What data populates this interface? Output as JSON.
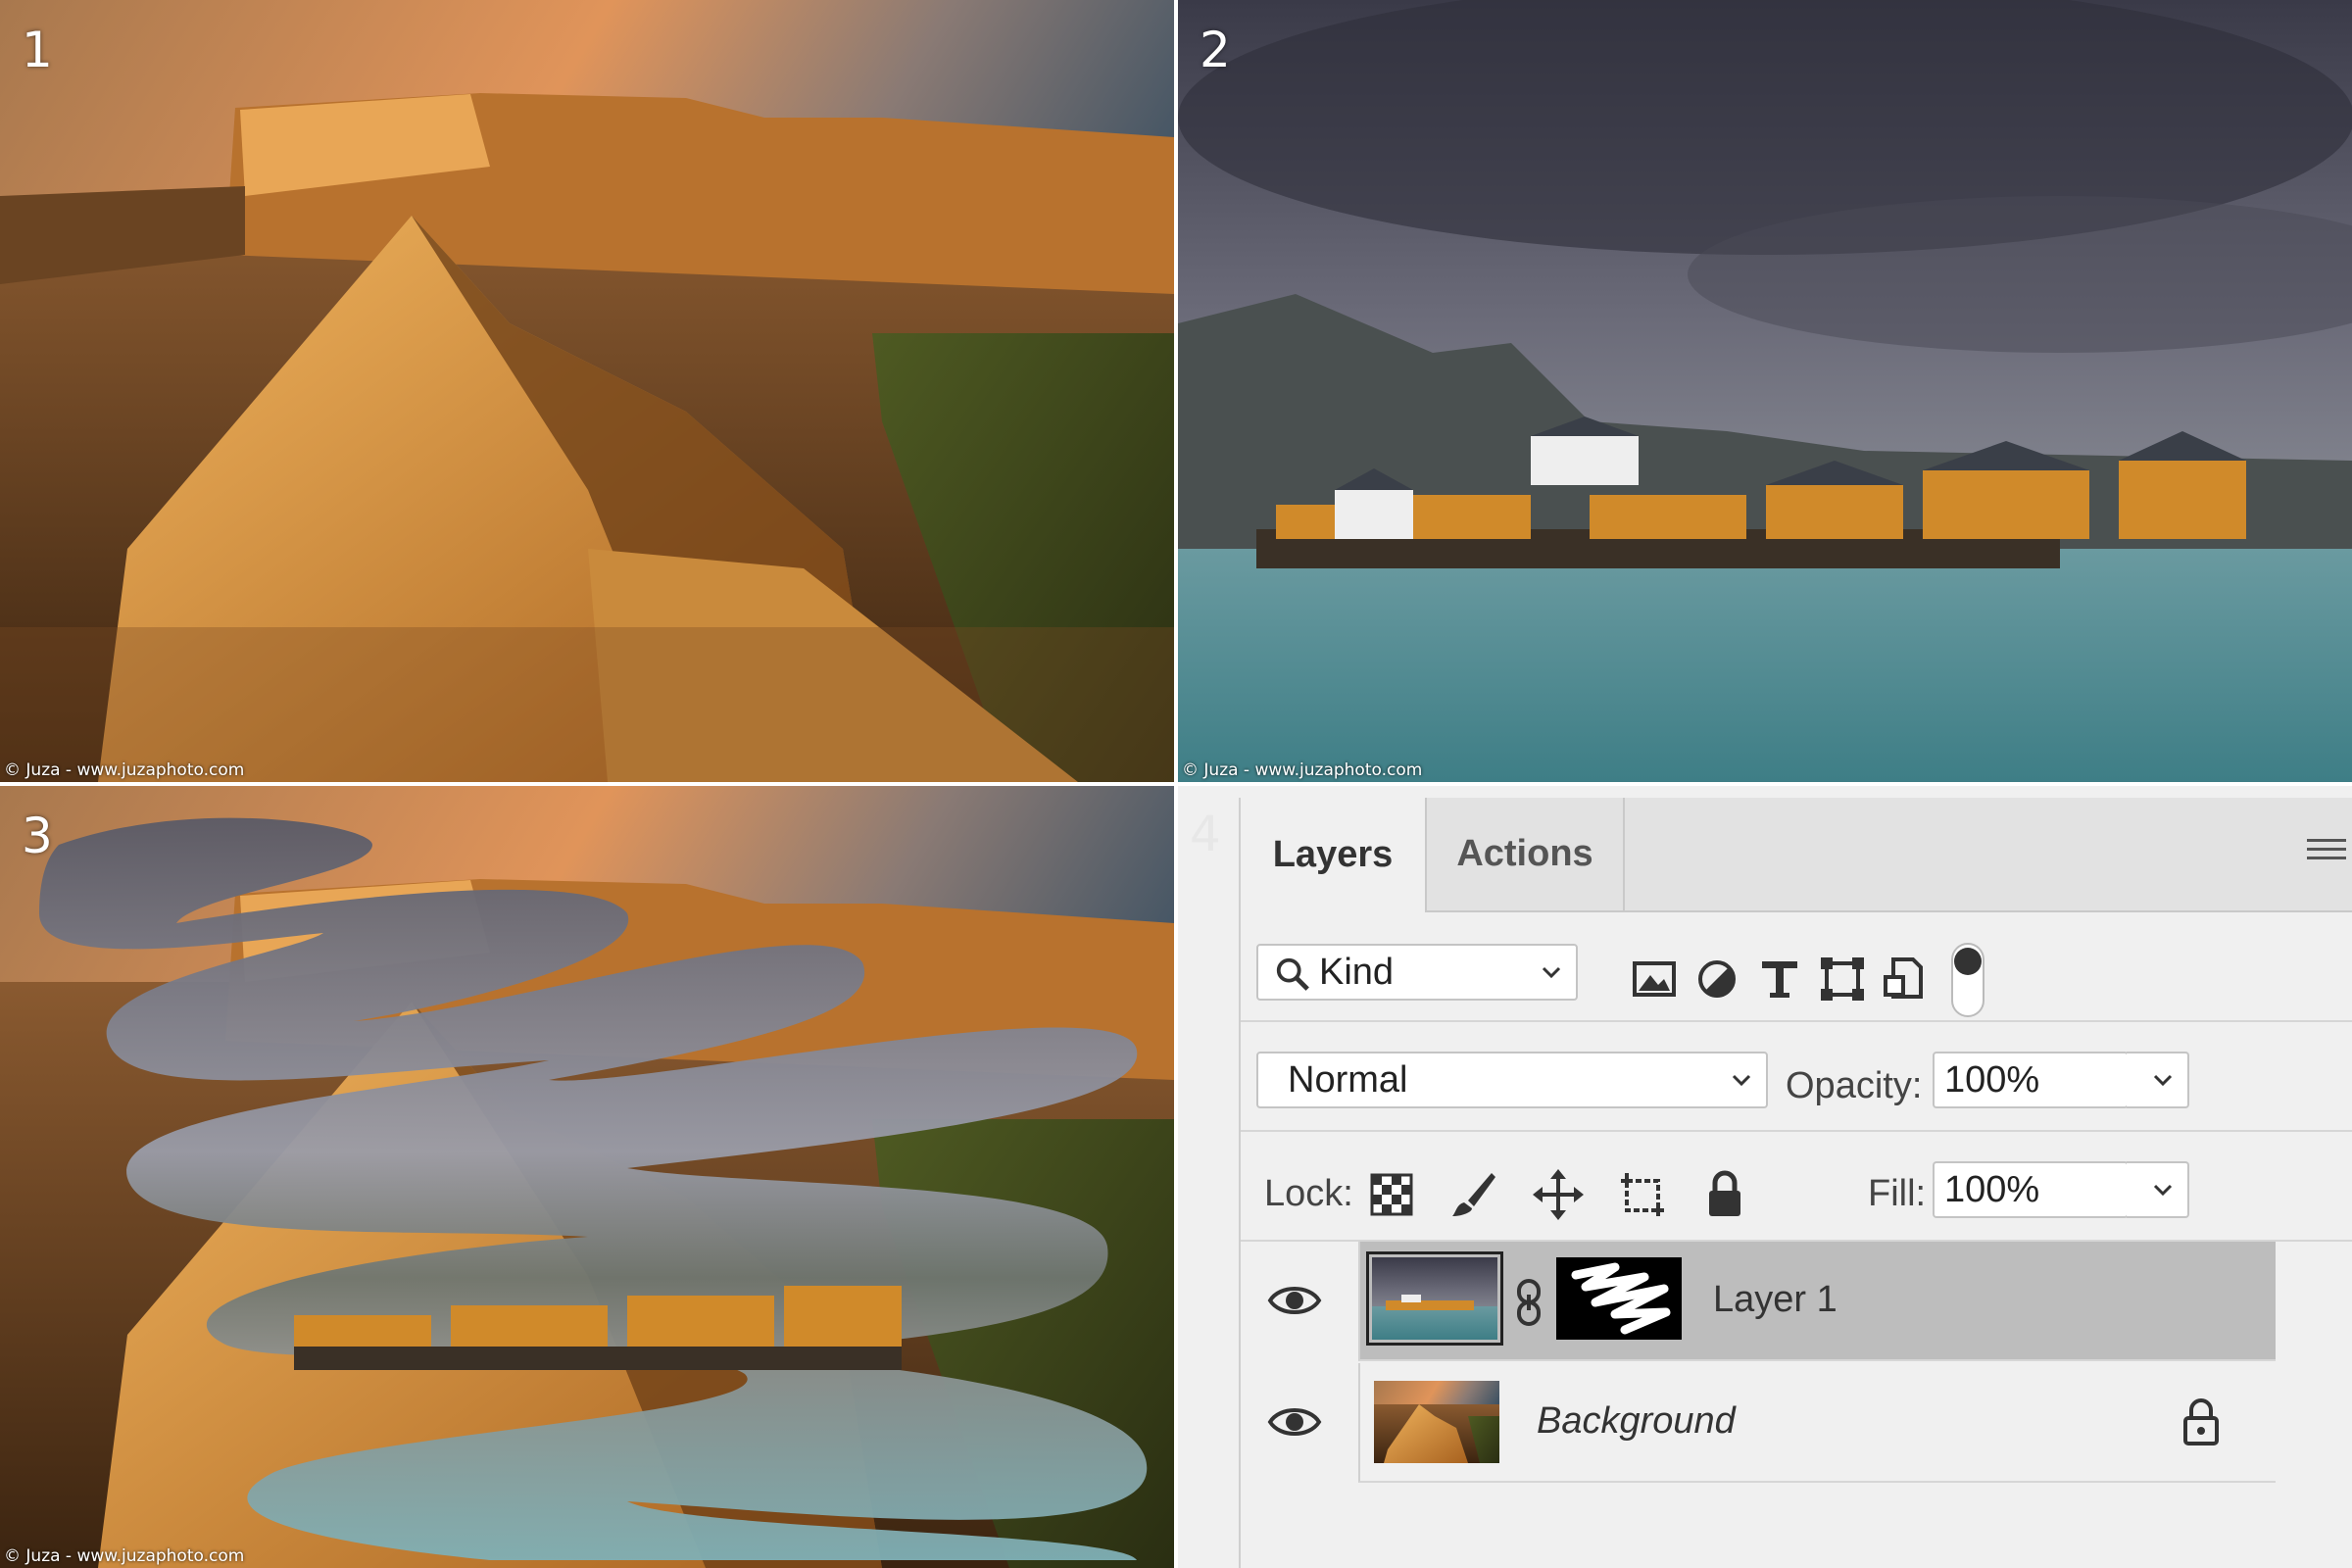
{
  "panels": {
    "p1": {
      "number": "1",
      "credit": "© Juza - www.juzaphoto.com"
    },
    "p2": {
      "number": "2",
      "credit": "© Juza - www.juzaphoto.com"
    },
    "p3": {
      "number": "3",
      "credit": "© Juza - www.juzaphoto.com"
    },
    "p4": {
      "number": "4"
    }
  },
  "layers_panel": {
    "tabs": [
      {
        "label": "Layers",
        "active": true
      },
      {
        "label": "Actions",
        "active": false
      }
    ],
    "filter": {
      "kind_label": "Kind",
      "icons": [
        "image-filter-icon",
        "adjustment-filter-icon",
        "type-filter-icon",
        "shape-filter-icon",
        "smart-object-filter-icon",
        "filter-toggle-icon"
      ]
    },
    "blend_mode": "Normal",
    "opacity_label": "Opacity:",
    "opacity_value": "100%",
    "lock_label": "Lock:",
    "lock_icons": [
      "lock-transparent-pixels-icon",
      "lock-image-pixels-icon",
      "lock-position-icon",
      "lock-artboard-icon",
      "lock-all-icon"
    ],
    "fill_label": "Fill:",
    "fill_value": "100%",
    "layers": [
      {
        "name": "Layer 1",
        "selected": true,
        "visible": true,
        "has_mask": true
      },
      {
        "name": "Background",
        "selected": false,
        "visible": true,
        "locked": true
      }
    ]
  },
  "colors": {
    "panel_bg": "#f0f0f0",
    "selected_layer": "#bdbdbd",
    "tab_bar": "#e2e2e2"
  }
}
